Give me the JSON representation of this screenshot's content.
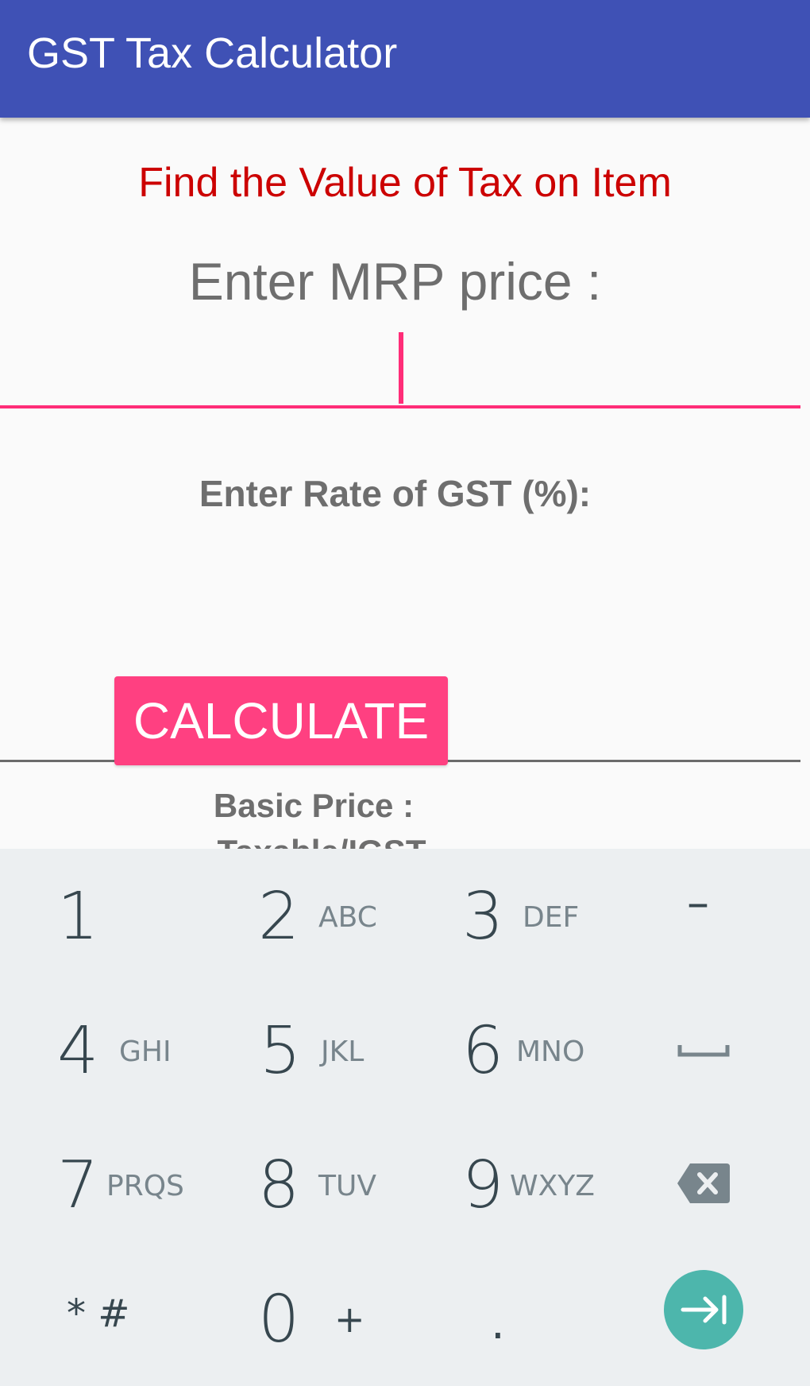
{
  "app": {
    "title": "GST Tax Calculator",
    "colors": {
      "primary": "#3f51b5",
      "accent": "#ff4081",
      "heading": "#cc0000",
      "enter_key": "#4db6ac"
    }
  },
  "form": {
    "heading": "Find the Value of Tax on Item",
    "mrp_label": "Enter MRP price :",
    "mrp_value": "",
    "gst_label": "Enter Rate of GST (%):",
    "gst_value": "",
    "calculate_label": "CALCULATE",
    "results": [
      "Basic Price :",
      "Taxable/IGST"
    ]
  },
  "keyboard": {
    "rows": [
      [
        {
          "digit": "1",
          "letters": ""
        },
        {
          "digit": "2",
          "letters": "ABC"
        },
        {
          "digit": "3",
          "letters": "DEF"
        },
        {
          "symbol": "–",
          "icon": "minus-icon"
        }
      ],
      [
        {
          "digit": "4",
          "letters": "GHI"
        },
        {
          "digit": "5",
          "letters": "JKL"
        },
        {
          "digit": "6",
          "letters": "MNO"
        },
        {
          "icon": "space-icon"
        }
      ],
      [
        {
          "digit": "7",
          "letters": "PRQS"
        },
        {
          "digit": "8",
          "letters": "TUV"
        },
        {
          "digit": "9",
          "letters": "WXYZ"
        },
        {
          "icon": "backspace-icon"
        }
      ],
      [
        {
          "symbol": "* #"
        },
        {
          "digit": "0",
          "letters": "+"
        },
        {
          "symbol": "."
        },
        {
          "icon": "next-field-icon"
        }
      ]
    ]
  }
}
